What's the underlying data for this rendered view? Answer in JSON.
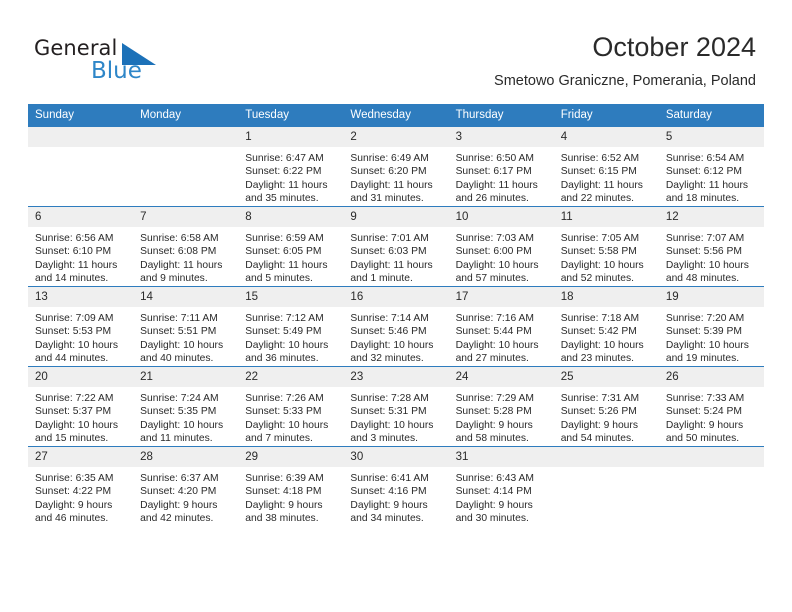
{
  "brand": {
    "name_part1": "General",
    "name_part2": "Blue",
    "logo_icon": "triangle-logo-icon",
    "color_primary": "#1c71b8",
    "color_secondary": "#2e86c8"
  },
  "header": {
    "title": "October 2024",
    "subtitle": "Smetowo Graniczne, Pomerania, Poland"
  },
  "theme": {
    "header_blue": "#2e7cbe",
    "daynum_gray": "#efefef",
    "text_dark": "#2a2a2a"
  },
  "calendar": {
    "weekday_headers": [
      "Sunday",
      "Monday",
      "Tuesday",
      "Wednesday",
      "Thursday",
      "Friday",
      "Saturday"
    ],
    "weeks": [
      [
        {
          "day": "",
          "sunrise": "",
          "sunset": "",
          "daylight_line1": "",
          "daylight_line2": ""
        },
        {
          "day": "",
          "sunrise": "",
          "sunset": "",
          "daylight_line1": "",
          "daylight_line2": ""
        },
        {
          "day": "1",
          "sunrise": "Sunrise: 6:47 AM",
          "sunset": "Sunset: 6:22 PM",
          "daylight_line1": "Daylight: 11 hours",
          "daylight_line2": "and 35 minutes."
        },
        {
          "day": "2",
          "sunrise": "Sunrise: 6:49 AM",
          "sunset": "Sunset: 6:20 PM",
          "daylight_line1": "Daylight: 11 hours",
          "daylight_line2": "and 31 minutes."
        },
        {
          "day": "3",
          "sunrise": "Sunrise: 6:50 AM",
          "sunset": "Sunset: 6:17 PM",
          "daylight_line1": "Daylight: 11 hours",
          "daylight_line2": "and 26 minutes."
        },
        {
          "day": "4",
          "sunrise": "Sunrise: 6:52 AM",
          "sunset": "Sunset: 6:15 PM",
          "daylight_line1": "Daylight: 11 hours",
          "daylight_line2": "and 22 minutes."
        },
        {
          "day": "5",
          "sunrise": "Sunrise: 6:54 AM",
          "sunset": "Sunset: 6:12 PM",
          "daylight_line1": "Daylight: 11 hours",
          "daylight_line2": "and 18 minutes."
        }
      ],
      [
        {
          "day": "6",
          "sunrise": "Sunrise: 6:56 AM",
          "sunset": "Sunset: 6:10 PM",
          "daylight_line1": "Daylight: 11 hours",
          "daylight_line2": "and 14 minutes."
        },
        {
          "day": "7",
          "sunrise": "Sunrise: 6:58 AM",
          "sunset": "Sunset: 6:08 PM",
          "daylight_line1": "Daylight: 11 hours",
          "daylight_line2": "and 9 minutes."
        },
        {
          "day": "8",
          "sunrise": "Sunrise: 6:59 AM",
          "sunset": "Sunset: 6:05 PM",
          "daylight_line1": "Daylight: 11 hours",
          "daylight_line2": "and 5 minutes."
        },
        {
          "day": "9",
          "sunrise": "Sunrise: 7:01 AM",
          "sunset": "Sunset: 6:03 PM",
          "daylight_line1": "Daylight: 11 hours",
          "daylight_line2": "and 1 minute."
        },
        {
          "day": "10",
          "sunrise": "Sunrise: 7:03 AM",
          "sunset": "Sunset: 6:00 PM",
          "daylight_line1": "Daylight: 10 hours",
          "daylight_line2": "and 57 minutes."
        },
        {
          "day": "11",
          "sunrise": "Sunrise: 7:05 AM",
          "sunset": "Sunset: 5:58 PM",
          "daylight_line1": "Daylight: 10 hours",
          "daylight_line2": "and 52 minutes."
        },
        {
          "day": "12",
          "sunrise": "Sunrise: 7:07 AM",
          "sunset": "Sunset: 5:56 PM",
          "daylight_line1": "Daylight: 10 hours",
          "daylight_line2": "and 48 minutes."
        }
      ],
      [
        {
          "day": "13",
          "sunrise": "Sunrise: 7:09 AM",
          "sunset": "Sunset: 5:53 PM",
          "daylight_line1": "Daylight: 10 hours",
          "daylight_line2": "and 44 minutes."
        },
        {
          "day": "14",
          "sunrise": "Sunrise: 7:11 AM",
          "sunset": "Sunset: 5:51 PM",
          "daylight_line1": "Daylight: 10 hours",
          "daylight_line2": "and 40 minutes."
        },
        {
          "day": "15",
          "sunrise": "Sunrise: 7:12 AM",
          "sunset": "Sunset: 5:49 PM",
          "daylight_line1": "Daylight: 10 hours",
          "daylight_line2": "and 36 minutes."
        },
        {
          "day": "16",
          "sunrise": "Sunrise: 7:14 AM",
          "sunset": "Sunset: 5:46 PM",
          "daylight_line1": "Daylight: 10 hours",
          "daylight_line2": "and 32 minutes."
        },
        {
          "day": "17",
          "sunrise": "Sunrise: 7:16 AM",
          "sunset": "Sunset: 5:44 PM",
          "daylight_line1": "Daylight: 10 hours",
          "daylight_line2": "and 27 minutes."
        },
        {
          "day": "18",
          "sunrise": "Sunrise: 7:18 AM",
          "sunset": "Sunset: 5:42 PM",
          "daylight_line1": "Daylight: 10 hours",
          "daylight_line2": "and 23 minutes."
        },
        {
          "day": "19",
          "sunrise": "Sunrise: 7:20 AM",
          "sunset": "Sunset: 5:39 PM",
          "daylight_line1": "Daylight: 10 hours",
          "daylight_line2": "and 19 minutes."
        }
      ],
      [
        {
          "day": "20",
          "sunrise": "Sunrise: 7:22 AM",
          "sunset": "Sunset: 5:37 PM",
          "daylight_line1": "Daylight: 10 hours",
          "daylight_line2": "and 15 minutes."
        },
        {
          "day": "21",
          "sunrise": "Sunrise: 7:24 AM",
          "sunset": "Sunset: 5:35 PM",
          "daylight_line1": "Daylight: 10 hours",
          "daylight_line2": "and 11 minutes."
        },
        {
          "day": "22",
          "sunrise": "Sunrise: 7:26 AM",
          "sunset": "Sunset: 5:33 PM",
          "daylight_line1": "Daylight: 10 hours",
          "daylight_line2": "and 7 minutes."
        },
        {
          "day": "23",
          "sunrise": "Sunrise: 7:28 AM",
          "sunset": "Sunset: 5:31 PM",
          "daylight_line1": "Daylight: 10 hours",
          "daylight_line2": "and 3 minutes."
        },
        {
          "day": "24",
          "sunrise": "Sunrise: 7:29 AM",
          "sunset": "Sunset: 5:28 PM",
          "daylight_line1": "Daylight: 9 hours",
          "daylight_line2": "and 58 minutes."
        },
        {
          "day": "25",
          "sunrise": "Sunrise: 7:31 AM",
          "sunset": "Sunset: 5:26 PM",
          "daylight_line1": "Daylight: 9 hours",
          "daylight_line2": "and 54 minutes."
        },
        {
          "day": "26",
          "sunrise": "Sunrise: 7:33 AM",
          "sunset": "Sunset: 5:24 PM",
          "daylight_line1": "Daylight: 9 hours",
          "daylight_line2": "and 50 minutes."
        }
      ],
      [
        {
          "day": "27",
          "sunrise": "Sunrise: 6:35 AM",
          "sunset": "Sunset: 4:22 PM",
          "daylight_line1": "Daylight: 9 hours",
          "daylight_line2": "and 46 minutes."
        },
        {
          "day": "28",
          "sunrise": "Sunrise: 6:37 AM",
          "sunset": "Sunset: 4:20 PM",
          "daylight_line1": "Daylight: 9 hours",
          "daylight_line2": "and 42 minutes."
        },
        {
          "day": "29",
          "sunrise": "Sunrise: 6:39 AM",
          "sunset": "Sunset: 4:18 PM",
          "daylight_line1": "Daylight: 9 hours",
          "daylight_line2": "and 38 minutes."
        },
        {
          "day": "30",
          "sunrise": "Sunrise: 6:41 AM",
          "sunset": "Sunset: 4:16 PM",
          "daylight_line1": "Daylight: 9 hours",
          "daylight_line2": "and 34 minutes."
        },
        {
          "day": "31",
          "sunrise": "Sunrise: 6:43 AM",
          "sunset": "Sunset: 4:14 PM",
          "daylight_line1": "Daylight: 9 hours",
          "daylight_line2": "and 30 minutes."
        },
        {
          "day": "",
          "sunrise": "",
          "sunset": "",
          "daylight_line1": "",
          "daylight_line2": ""
        },
        {
          "day": "",
          "sunrise": "",
          "sunset": "",
          "daylight_line1": "",
          "daylight_line2": ""
        }
      ]
    ]
  }
}
